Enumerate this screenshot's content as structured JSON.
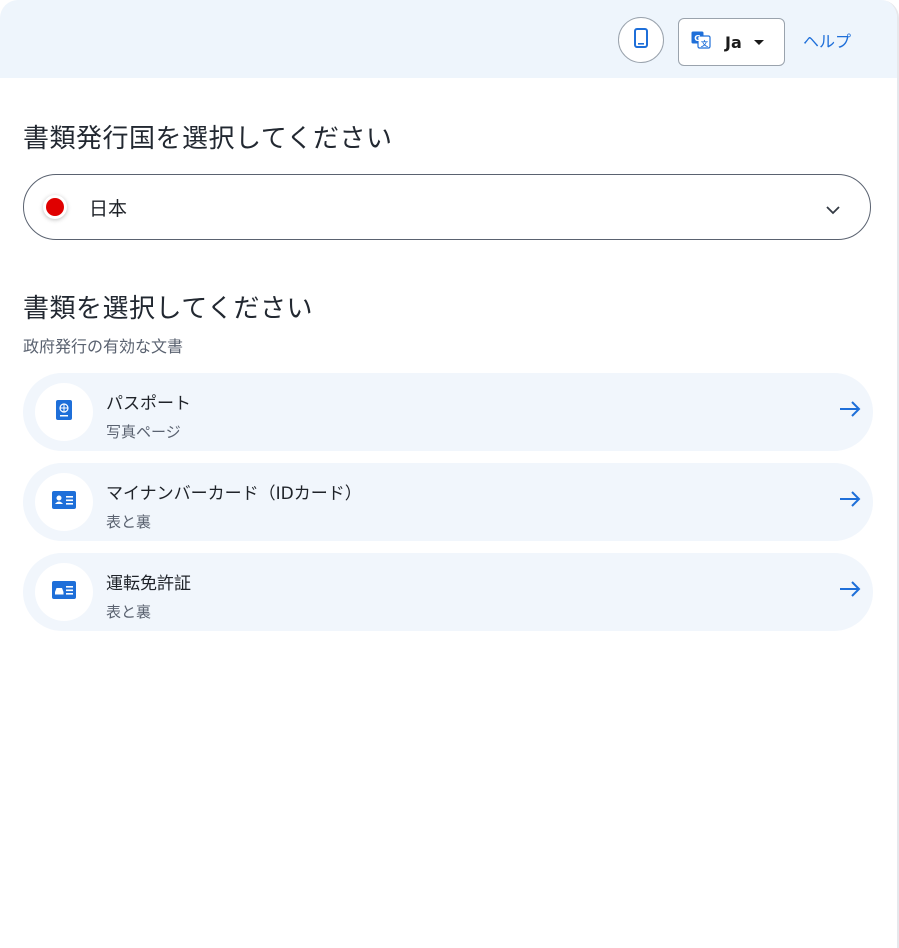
{
  "header": {
    "help_label": "ヘルプ",
    "language": {
      "code": "Ja"
    },
    "icons": {
      "device": "smartphone-icon",
      "language": "translate-icon",
      "language_caret": "caret-down-icon"
    }
  },
  "country_section": {
    "title": "書類発行国を選択してください",
    "selected_country": "日本",
    "flag_color": "#e00000",
    "dropdown_icon": "chevron-down-icon"
  },
  "document_section": {
    "title": "書類を選択してください",
    "subtitle": "政府発行の有効な文書",
    "documents": [
      {
        "title": "パスポート",
        "subtitle": "写真ページ",
        "icon": "passport-icon"
      },
      {
        "title": "マイナンバーカード（IDカード）",
        "subtitle": "表と裏",
        "icon": "id-card-icon"
      },
      {
        "title": "運転免許証",
        "subtitle": "表と裏",
        "icon": "drivers-license-icon"
      }
    ]
  },
  "colors": {
    "accent": "#1e6fd9",
    "header_bg": "#eef5fc",
    "card_bg": "#f1f6fc"
  }
}
